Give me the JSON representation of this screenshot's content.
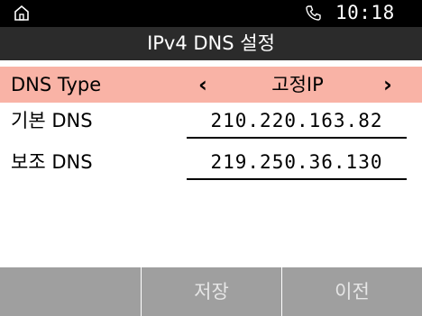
{
  "status_bar": {
    "time": "10:18",
    "home_icon": "home-icon",
    "phone_icon": "phone-icon"
  },
  "title": "IPv4 DNS 설정",
  "dns_type": {
    "label": "DNS Type",
    "value": "고정IP",
    "prev": "‹",
    "next": "›"
  },
  "primary_dns": {
    "label": "기본 DNS",
    "value": "210.220.163.82"
  },
  "secondary_dns": {
    "label": "보조 DNS",
    "value": "219.250.36.130"
  },
  "softkeys": {
    "left": "",
    "middle": "저장",
    "right": "이전"
  },
  "colors": {
    "selected_row": "#f9b3a6",
    "softkey_bar": "#9f9f9f",
    "title_bar": "#2b2b2b",
    "status_bar": "#000000"
  }
}
